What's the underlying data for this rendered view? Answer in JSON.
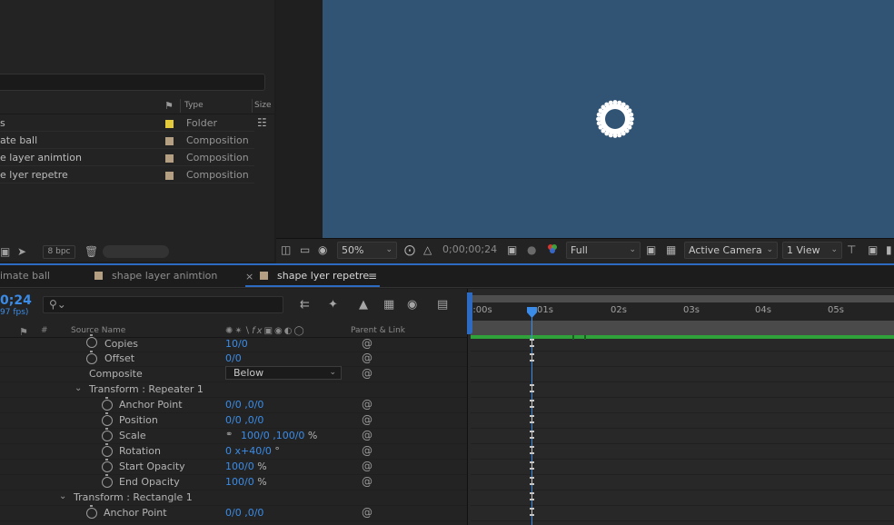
{
  "project": {
    "columns": {
      "type": "Type",
      "size": "Size"
    },
    "items": [
      {
        "name": "s",
        "type": "Folder",
        "swatch": "#e3c93c"
      },
      {
        "name": "ate ball",
        "type": "Composition",
        "swatch": "#b59f83"
      },
      {
        "name": "e layer animtion",
        "type": "Composition",
        "swatch": "#b59f83"
      },
      {
        "name": "e lyer repetre",
        "type": "Composition",
        "swatch": "#b59f83"
      }
    ],
    "footer": {
      "bpc": "8 bpc"
    }
  },
  "viewer": {
    "canvas_color": "#325474",
    "toolbar": {
      "zoom": "50%",
      "timecode": "0;00;00;24",
      "resolution": "Full",
      "camera": "Active Camera",
      "views": "1 View"
    }
  },
  "timeline": {
    "tabs": [
      {
        "label": "imate ball"
      },
      {
        "label": "shape layer animtion"
      },
      {
        "label": "shape lyer repetre",
        "active": true
      }
    ],
    "close_glyph": "×",
    "menu_glyph": "≡",
    "current_time": "0;24",
    "fps": "97 fps)",
    "header": {
      "source_name": "Source Name",
      "parent_link": "Parent & Link",
      "hash": "#"
    },
    "properties": [
      {
        "label": "Copies",
        "value": "10/0",
        "unit": ""
      },
      {
        "label": "Offset",
        "value": "0/0",
        "unit": ""
      },
      {
        "label": "Composite",
        "value": "Below",
        "unit": ""
      },
      {
        "label": "Transform : Repeater 1",
        "value": "",
        "unit": ""
      },
      {
        "label": "Anchor Point",
        "value": "0/0 ,0/0",
        "unit": ""
      },
      {
        "label": "Position",
        "value": "0/0 ,0/0",
        "unit": ""
      },
      {
        "label": "Scale",
        "value": "100/0 ,100/0",
        "unit": " %"
      },
      {
        "label": "Rotation",
        "value": "0 x+40/0",
        "unit": " °"
      },
      {
        "label": "Start Opacity",
        "value": "100/0",
        "unit": " %"
      },
      {
        "label": "End Opacity",
        "value": "100/0",
        "unit": " %"
      },
      {
        "label": "Transform : Rectangle 1",
        "value": "",
        "unit": ""
      },
      {
        "label": "Anchor Point",
        "value": "0/0 ,0/0",
        "unit": ""
      }
    ],
    "ruler": [
      "0:00s",
      "01s",
      "02s",
      "03s",
      "04s",
      "05s"
    ],
    "accent_color": "#3b8ce8",
    "bar_color": "#2fa23a"
  }
}
